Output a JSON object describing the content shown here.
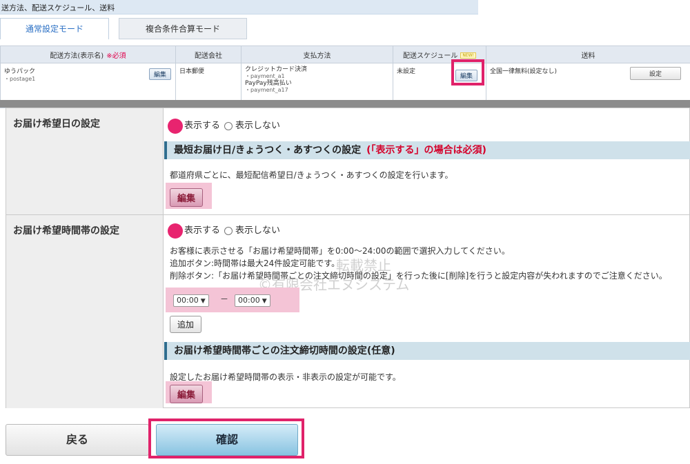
{
  "top": {
    "breadcrumb": "送方法、配送スケジュール、送料",
    "tabs": [
      {
        "label": "通常設定モード"
      },
      {
        "label": "複合条件合算モード"
      }
    ]
  },
  "shipping_table": {
    "headers": {
      "method": "配送方法(表示名)",
      "method_required": "※必須",
      "company": "配送会社",
      "payment": "支払方法",
      "schedule": "配送スケジュール",
      "schedule_badge": "NEW!",
      "fee": "送料"
    },
    "row": {
      "method_name": "ゆうパック",
      "method_code": "・postage1",
      "edit_label": "編集",
      "company": "日本郵便",
      "payment_lines": [
        "クレジットカード決済",
        "・payment_a1",
        "PayPay残高払い",
        "・payment_a17"
      ],
      "schedule": "未設定",
      "schedule_edit_label": "編集",
      "fee": "全国一律無料(設定なし)",
      "fee_button": "設定"
    }
  },
  "delivery_date": {
    "label": "お届け希望日の設定",
    "radio_show": "表示する",
    "radio_hide": "表示しない",
    "section_title": "最短お届け日/きょうつく・あすつくの設定",
    "section_required": "(「表示する」の場合は必須)",
    "description": "都道府県ごとに、最短配信希望日/きょうつく・あすつくの設定を行います。",
    "edit_label": "編集"
  },
  "delivery_time": {
    "label": "お届け希望時間帯の設定",
    "radio_show": "表示する",
    "radio_hide": "表示しない",
    "desc1": "お客様に表示させる「お届け希望時間帯」を0:00～24:00の範囲で選択入力してください。",
    "desc2": "追加ボタン:時間帯は最大24件設定可能です。",
    "desc3": "削除ボタン:「お届け希望時間帯ごとの注文締切時間の設定」を行った後に[削除]を行うと設定内容が失われますのでご注意ください。",
    "time_from": "00:00",
    "time_sep": "－",
    "time_to": "00:00",
    "add_label": "追加",
    "section_title": "お届け希望時間帯ごとの注文締切時間の設定(任意)",
    "section_desc": "設定したお届け希望時間帯の表示・非表示の設定が可能です。",
    "edit_label": "編集"
  },
  "watermark": {
    "line1": "転載禁止",
    "line2": "©有限会社エヌシステム"
  },
  "footer": {
    "back_label": "戻る",
    "confirm_label": "確認"
  },
  "colors": {
    "highlight": "#e0226a",
    "section_bar": "#cfe1ea",
    "confirm_button": "#88c3e1"
  }
}
